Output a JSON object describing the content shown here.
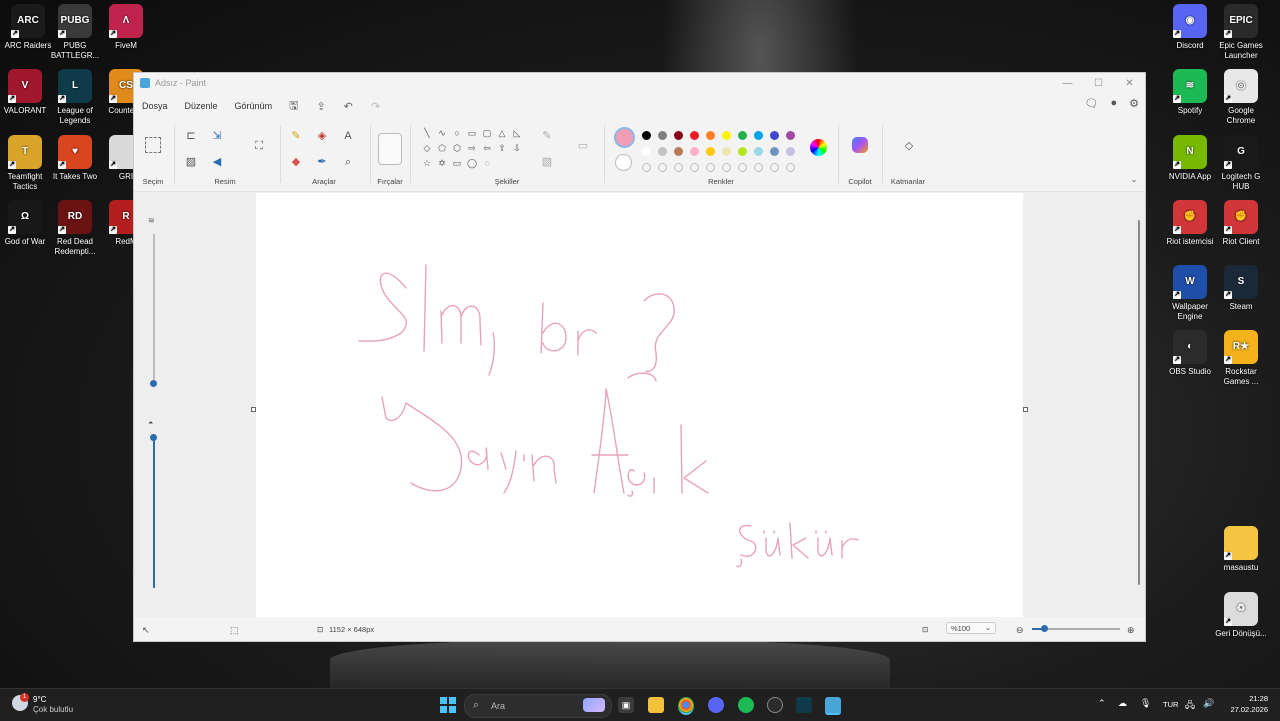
{
  "desktop": {
    "left_icons": [
      {
        "label": "ARC Raiders",
        "color": "#1b1b1b",
        "glyph": "ARC"
      },
      {
        "label": "PUBG BATTLEGR...",
        "color": "#3a3a3a",
        "glyph": "PUBG"
      },
      {
        "label": "FiveM",
        "color": "#c0244d",
        "glyph": "Λ"
      },
      {
        "label": "VALORANT",
        "color": "#a0182d",
        "glyph": "V"
      },
      {
        "label": "League of Legends",
        "color": "#0e3a4a",
        "glyph": "L"
      },
      {
        "label": "Counter 2",
        "color": "#e08a1a",
        "glyph": "CS"
      },
      {
        "label": "Teamfight Tactics",
        "color": "#d9a42a",
        "glyph": "T"
      },
      {
        "label": "It Takes Two",
        "color": "#d9451f",
        "glyph": "♥"
      },
      {
        "label": "GRI",
        "color": "#dadada",
        "glyph": ""
      },
      {
        "label": "God of War",
        "color": "#181818",
        "glyph": "Ω"
      },
      {
        "label": "Red Dead Redempti...",
        "color": "#6b1313",
        "glyph": "RD"
      },
      {
        "label": "RedM",
        "color": "#b51e1e",
        "glyph": "R"
      }
    ],
    "right_icons": [
      {
        "label": "Discord",
        "color": "#5865f2",
        "glyph": "◉"
      },
      {
        "label": "Epic Games Launcher",
        "color": "#2a2a2a",
        "glyph": "EPIC"
      },
      {
        "label": "Spotify",
        "color": "#1db954",
        "glyph": "≋"
      },
      {
        "label": "Google Chrome",
        "color": "#e8e8e8",
        "glyph": "◎"
      },
      {
        "label": "NVIDIA App",
        "color": "#76b900",
        "glyph": "N"
      },
      {
        "label": "Logitech G HUB",
        "color": "#1a1a1a",
        "glyph": "G"
      },
      {
        "label": "Riot istemcisi",
        "color": "#d13639",
        "glyph": "✊"
      },
      {
        "label": "Riot Client",
        "color": "#d13639",
        "glyph": "✊"
      },
      {
        "label": "Wallpaper Engine",
        "color": "#1f4fa8",
        "glyph": "W"
      },
      {
        "label": "Steam",
        "color": "#1b2838",
        "glyph": "S"
      },
      {
        "label": "OBS Studio",
        "color": "#2b2b2b",
        "glyph": "◐"
      },
      {
        "label": "Rockstar Games ...",
        "color": "#f3b11b",
        "glyph": "R★"
      },
      {
        "label": "masaustu",
        "color": "#f5c542",
        "glyph": ""
      },
      {
        "label": "Geri Dönüşü...",
        "color": "#dcdcdc",
        "glyph": "♻"
      }
    ]
  },
  "window": {
    "title": "Adsız - Paint",
    "controls": [
      "—",
      "☐",
      "✕"
    ],
    "menu": [
      "Dosya",
      "Düzenle",
      "Görünüm"
    ],
    "toolbar_icons": [
      "save-icon",
      "share-icon",
      "undo-icon",
      "redo-icon"
    ],
    "right_icons": [
      "comment-icon",
      "profile-icon",
      "settings-icon"
    ]
  },
  "ribbon": {
    "groups": {
      "selection": "Seçim",
      "image": "Resim",
      "tools": "Araçlar",
      "brushes": "Fırçalar",
      "shapes": "Şekiller",
      "colors": "Renkler",
      "copilot": "Copilot",
      "layers": "Katmanlar"
    },
    "active_color": "#f19db5",
    "palette_row1": [
      "#000000",
      "#7f7f7f",
      "#880015",
      "#ed1c24",
      "#ff7f27",
      "#fff200",
      "#22b14c",
      "#00a2e8",
      "#3f48cc",
      "#a349a4"
    ],
    "palette_row2": [
      "#ffffff",
      "#c3c3c3",
      "#b97a57",
      "#ffaec9",
      "#ffc90e",
      "#efe4b0",
      "#b5e61d",
      "#99d9ea",
      "#7092be",
      "#c8bfe7"
    ]
  },
  "canvas": {
    "ink_color": "#e8a3b8",
    "strokes_described": [
      "Slm, nbr?",
      "Yayın Açık",
      "Şükür"
    ]
  },
  "status": {
    "canvas_size": "1152 × 648px",
    "zoom": "%100"
  },
  "taskbar": {
    "weather_temp": "9°C",
    "weather_text": "Çok bulutlu",
    "search_placeholder": "Ara",
    "language": "TUR",
    "time": "21:28",
    "date": "27.02.2026",
    "notification_count": "1"
  }
}
